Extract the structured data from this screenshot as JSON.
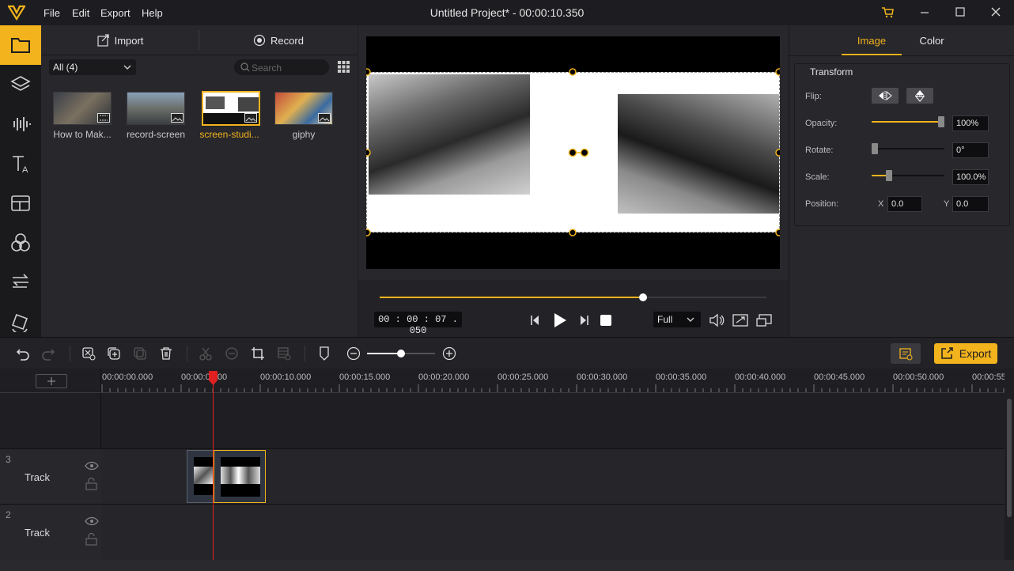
{
  "app": {
    "title": "Untitled Project* - 00:00:10.350",
    "menu": [
      "File",
      "Edit",
      "Export",
      "Help"
    ]
  },
  "media": {
    "import_label": "Import",
    "record_label": "Record",
    "filter": "All (4)",
    "search_placeholder": "Search",
    "items": [
      {
        "label": "How to Mak..."
      },
      {
        "label": "record-screen"
      },
      {
        "label": "screen-studi..."
      },
      {
        "label": "giphy"
      }
    ]
  },
  "player": {
    "timecode": "00 : 00 : 07 . 050",
    "zoom": "Full",
    "progress": 0.68
  },
  "properties": {
    "tabs": [
      "Image",
      "Color"
    ],
    "section": "Transform",
    "flip_label": "Flip:",
    "opacity_label": "Opacity:",
    "opacity_value": "100%",
    "opacity_level": 1.0,
    "rotate_label": "Rotate:",
    "rotate_value": "0°",
    "rotate_level": 0.0,
    "scale_label": "Scale:",
    "scale_value": "100.0%",
    "scale_level": 0.24,
    "position_label": "Position:",
    "x_label": "X",
    "x_value": "0.0",
    "y_label": "Y",
    "y_value": "0.0"
  },
  "toolbar": {
    "export_label": "Export",
    "zoom_level": 0.5
  },
  "timeline": {
    "ruler": [
      "00:00:00.000",
      "00:00:0.000",
      "00:00:10.000",
      "00:00:15.000",
      "00:00:20.000",
      "00:00:25.000",
      "00:00:30.000",
      "00:00:35.000",
      "00:00:40.000",
      "00:00:45.000",
      "00:00:50.000",
      "00:00:55"
    ],
    "tracks": [
      {
        "number": "3",
        "label": "Track"
      },
      {
        "number": "2",
        "label": "Track"
      }
    ]
  },
  "colors": {
    "accent": "#f2b31c",
    "playhead": "#e02020"
  }
}
